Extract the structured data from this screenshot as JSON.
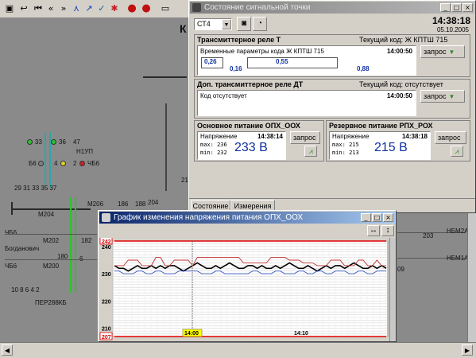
{
  "main": {
    "labels": {
      "k": "К",
      "n33": "33",
      "n36": "36",
      "n47": "47",
      "n1up": "Н1УП",
      "b6": "Б6",
      "n4": "4",
      "n2": "2",
      "ch6": "ЧБ6",
      "row_nums": "29  31  33  35  37",
      "m206": "М206",
      "n186": "186",
      "n188": "188",
      "n204": "204",
      "m204": "М204",
      "ch6b": "ЧБ6",
      "m202": "М202",
      "n182": "182",
      "n203": "203",
      "bogdanovich": "Богданович",
      "n180": "180",
      "n6": "6",
      "ch6c": "ЧБ6",
      "m200": "М200",
      "bottom_nums": "10  8  6  4  2",
      "per": "ПЕР288КБ",
      "nbm2a": "НБМ2А",
      "nbm1a": "НБМ1А",
      "n09": "09",
      "n21": "21"
    }
  },
  "sp_window": {
    "title": "Состояние сигнальной точки",
    "select_value": "СТ4",
    "time": "14:38:18",
    "date": "05.10.2005",
    "group1": {
      "title": "Трансмиттерное реле Т",
      "code": "Текущий код: Ж КПТШ 715",
      "line": "Временные параметры кода Ж КПТШ 715",
      "time": "14:00:50",
      "v1": "0,26",
      "v2": "0,16",
      "v3": "0,55",
      "v4": "0,88",
      "query": "запрос"
    },
    "group2": {
      "title": "Доп. трансмиттерное реле ДТ",
      "code": "Текущий код: отсутствует",
      "line": "Код отсутствует",
      "time": "14:00:50",
      "query": "запрос"
    },
    "group3": {
      "title": "Основное питание ОПХ_ООХ",
      "label": "Напряжение",
      "time": "14:38:14",
      "max": "max: 236",
      "min": "min: 232",
      "value": "233 В",
      "query": "запрос"
    },
    "group4": {
      "title": "Резервное питание РПХ_РОХ",
      "label": "Напряжение",
      "time": "14:38:18",
      "max": "max: 215",
      "min": "min: 213",
      "value": "215 В",
      "query": "запрос"
    },
    "tabs": [
      "Состояние",
      "Измерения"
    ]
  },
  "chart_window": {
    "title": "График изменения напряжения питания ОПХ_ООХ"
  },
  "chart_data": {
    "type": "line",
    "title": "",
    "xlabel": "",
    "ylabel": "",
    "ylim": [
      207,
      242
    ],
    "y_ticks": [
      "242",
      "240",
      "230",
      "220",
      "210",
      "207"
    ],
    "x_ticks": [
      "14:00",
      "14:10"
    ],
    "series": [
      {
        "color": "#000000",
        "values": [
          233,
          232,
          232,
          231,
          232,
          233,
          232,
          232,
          233,
          232,
          233,
          232,
          233,
          233,
          232,
          231,
          232,
          233,
          234,
          233,
          232,
          232,
          233,
          232,
          233,
          234,
          233,
          232,
          232,
          233,
          233,
          232,
          233,
          232,
          232,
          233,
          232,
          233,
          234,
          233,
          232,
          232,
          233,
          232,
          231,
          232,
          233,
          232,
          233,
          233,
          232,
          233,
          234,
          233,
          232,
          232,
          233,
          232,
          233,
          232
        ]
      },
      {
        "color": "#c03030",
        "values": [
          233,
          233,
          233,
          235,
          235,
          235,
          233,
          233,
          233,
          236,
          236,
          233,
          233,
          235,
          235,
          235,
          235,
          233,
          236,
          236,
          236,
          236,
          236,
          236,
          236,
          236,
          236,
          236,
          234,
          234,
          234,
          234,
          234,
          234,
          236,
          236,
          236,
          236,
          235,
          235,
          235,
          234,
          234,
          234,
          233,
          233,
          233,
          235,
          235,
          235,
          233,
          233,
          233,
          235,
          235,
          233,
          233,
          235,
          233,
          233
        ]
      },
      {
        "color": "#3050c0",
        "values": [
          231,
          231,
          230,
          230,
          230,
          231,
          231,
          230,
          230,
          231,
          231,
          230,
          230,
          230,
          231,
          231,
          231,
          231,
          231,
          230,
          230,
          230,
          231,
          231,
          230,
          230,
          230,
          230,
          230,
          230,
          231,
          231,
          230,
          230,
          230,
          231,
          231,
          230,
          230,
          230,
          231,
          231,
          230,
          230,
          231,
          231,
          230,
          230,
          231,
          231,
          231,
          230,
          230,
          231,
          231,
          230,
          230,
          231,
          231,
          231
        ]
      },
      {
        "color": "#e00000",
        "values": [
          242,
          242,
          242,
          242,
          242,
          242,
          242,
          242,
          242,
          242,
          242,
          242,
          242,
          242,
          242,
          242,
          242,
          242,
          242,
          242,
          242,
          242,
          242,
          242,
          242,
          242,
          242,
          242,
          242,
          242,
          242,
          242,
          242,
          242,
          242,
          242,
          242,
          242,
          242,
          242,
          242,
          242,
          242,
          242,
          242,
          242,
          242,
          242,
          242,
          242,
          242,
          242,
          242,
          242,
          242,
          242,
          242,
          242,
          242,
          242
        ]
      },
      {
        "color": "#e00000",
        "values": [
          207,
          207,
          207,
          207,
          207,
          207,
          207,
          207,
          207,
          207,
          207,
          207,
          207,
          207,
          207,
          207,
          207,
          207,
          207,
          207,
          207,
          207,
          207,
          207,
          207,
          207,
          207,
          207,
          207,
          207,
          207,
          207,
          207,
          207,
          207,
          207,
          207,
          207,
          207,
          207,
          207,
          207,
          207,
          207,
          207,
          207,
          207,
          207,
          207,
          207,
          207,
          207,
          207,
          207,
          207,
          207,
          207,
          207,
          207,
          207
        ]
      }
    ]
  }
}
